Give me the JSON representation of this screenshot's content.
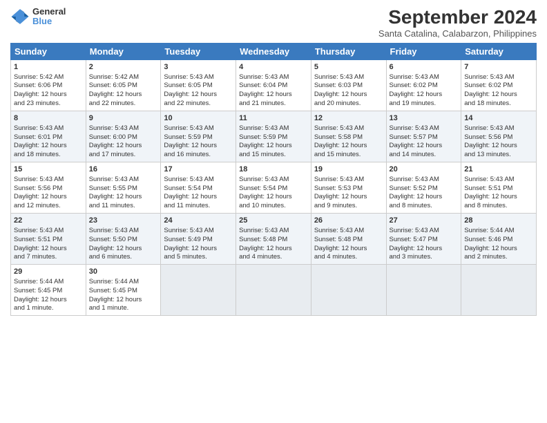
{
  "header": {
    "title": "September 2024",
    "location": "Santa Catalina, Calabarzon, Philippines",
    "logo_line1": "General",
    "logo_line2": "Blue"
  },
  "weekdays": [
    "Sunday",
    "Monday",
    "Tuesday",
    "Wednesday",
    "Thursday",
    "Friday",
    "Saturday"
  ],
  "weeks": [
    [
      {
        "day": "1",
        "lines": [
          "Sunrise: 5:42 AM",
          "Sunset: 6:06 PM",
          "Daylight: 12 hours",
          "and 23 minutes."
        ]
      },
      {
        "day": "2",
        "lines": [
          "Sunrise: 5:42 AM",
          "Sunset: 6:05 PM",
          "Daylight: 12 hours",
          "and 22 minutes."
        ]
      },
      {
        "day": "3",
        "lines": [
          "Sunrise: 5:43 AM",
          "Sunset: 6:05 PM",
          "Daylight: 12 hours",
          "and 22 minutes."
        ]
      },
      {
        "day": "4",
        "lines": [
          "Sunrise: 5:43 AM",
          "Sunset: 6:04 PM",
          "Daylight: 12 hours",
          "and 21 minutes."
        ]
      },
      {
        "day": "5",
        "lines": [
          "Sunrise: 5:43 AM",
          "Sunset: 6:03 PM",
          "Daylight: 12 hours",
          "and 20 minutes."
        ]
      },
      {
        "day": "6",
        "lines": [
          "Sunrise: 5:43 AM",
          "Sunset: 6:02 PM",
          "Daylight: 12 hours",
          "and 19 minutes."
        ]
      },
      {
        "day": "7",
        "lines": [
          "Sunrise: 5:43 AM",
          "Sunset: 6:02 PM",
          "Daylight: 12 hours",
          "and 18 minutes."
        ]
      }
    ],
    [
      {
        "day": "8",
        "lines": [
          "Sunrise: 5:43 AM",
          "Sunset: 6:01 PM",
          "Daylight: 12 hours",
          "and 18 minutes."
        ]
      },
      {
        "day": "9",
        "lines": [
          "Sunrise: 5:43 AM",
          "Sunset: 6:00 PM",
          "Daylight: 12 hours",
          "and 17 minutes."
        ]
      },
      {
        "day": "10",
        "lines": [
          "Sunrise: 5:43 AM",
          "Sunset: 5:59 PM",
          "Daylight: 12 hours",
          "and 16 minutes."
        ]
      },
      {
        "day": "11",
        "lines": [
          "Sunrise: 5:43 AM",
          "Sunset: 5:59 PM",
          "Daylight: 12 hours",
          "and 15 minutes."
        ]
      },
      {
        "day": "12",
        "lines": [
          "Sunrise: 5:43 AM",
          "Sunset: 5:58 PM",
          "Daylight: 12 hours",
          "and 15 minutes."
        ]
      },
      {
        "day": "13",
        "lines": [
          "Sunrise: 5:43 AM",
          "Sunset: 5:57 PM",
          "Daylight: 12 hours",
          "and 14 minutes."
        ]
      },
      {
        "day": "14",
        "lines": [
          "Sunrise: 5:43 AM",
          "Sunset: 5:56 PM",
          "Daylight: 12 hours",
          "and 13 minutes."
        ]
      }
    ],
    [
      {
        "day": "15",
        "lines": [
          "Sunrise: 5:43 AM",
          "Sunset: 5:56 PM",
          "Daylight: 12 hours",
          "and 12 minutes."
        ]
      },
      {
        "day": "16",
        "lines": [
          "Sunrise: 5:43 AM",
          "Sunset: 5:55 PM",
          "Daylight: 12 hours",
          "and 11 minutes."
        ]
      },
      {
        "day": "17",
        "lines": [
          "Sunrise: 5:43 AM",
          "Sunset: 5:54 PM",
          "Daylight: 12 hours",
          "and 11 minutes."
        ]
      },
      {
        "day": "18",
        "lines": [
          "Sunrise: 5:43 AM",
          "Sunset: 5:54 PM",
          "Daylight: 12 hours",
          "and 10 minutes."
        ]
      },
      {
        "day": "19",
        "lines": [
          "Sunrise: 5:43 AM",
          "Sunset: 5:53 PM",
          "Daylight: 12 hours",
          "and 9 minutes."
        ]
      },
      {
        "day": "20",
        "lines": [
          "Sunrise: 5:43 AM",
          "Sunset: 5:52 PM",
          "Daylight: 12 hours",
          "and 8 minutes."
        ]
      },
      {
        "day": "21",
        "lines": [
          "Sunrise: 5:43 AM",
          "Sunset: 5:51 PM",
          "Daylight: 12 hours",
          "and 8 minutes."
        ]
      }
    ],
    [
      {
        "day": "22",
        "lines": [
          "Sunrise: 5:43 AM",
          "Sunset: 5:51 PM",
          "Daylight: 12 hours",
          "and 7 minutes."
        ]
      },
      {
        "day": "23",
        "lines": [
          "Sunrise: 5:43 AM",
          "Sunset: 5:50 PM",
          "Daylight: 12 hours",
          "and 6 minutes."
        ]
      },
      {
        "day": "24",
        "lines": [
          "Sunrise: 5:43 AM",
          "Sunset: 5:49 PM",
          "Daylight: 12 hours",
          "and 5 minutes."
        ]
      },
      {
        "day": "25",
        "lines": [
          "Sunrise: 5:43 AM",
          "Sunset: 5:48 PM",
          "Daylight: 12 hours",
          "and 4 minutes."
        ]
      },
      {
        "day": "26",
        "lines": [
          "Sunrise: 5:43 AM",
          "Sunset: 5:48 PM",
          "Daylight: 12 hours",
          "and 4 minutes."
        ]
      },
      {
        "day": "27",
        "lines": [
          "Sunrise: 5:43 AM",
          "Sunset: 5:47 PM",
          "Daylight: 12 hours",
          "and 3 minutes."
        ]
      },
      {
        "day": "28",
        "lines": [
          "Sunrise: 5:44 AM",
          "Sunset: 5:46 PM",
          "Daylight: 12 hours",
          "and 2 minutes."
        ]
      }
    ],
    [
      {
        "day": "29",
        "lines": [
          "Sunrise: 5:44 AM",
          "Sunset: 5:45 PM",
          "Daylight: 12 hours",
          "and 1 minute."
        ]
      },
      {
        "day": "30",
        "lines": [
          "Sunrise: 5:44 AM",
          "Sunset: 5:45 PM",
          "Daylight: 12 hours",
          "and 1 minute."
        ]
      },
      {
        "day": "",
        "lines": []
      },
      {
        "day": "",
        "lines": []
      },
      {
        "day": "",
        "lines": []
      },
      {
        "day": "",
        "lines": []
      },
      {
        "day": "",
        "lines": []
      }
    ]
  ]
}
